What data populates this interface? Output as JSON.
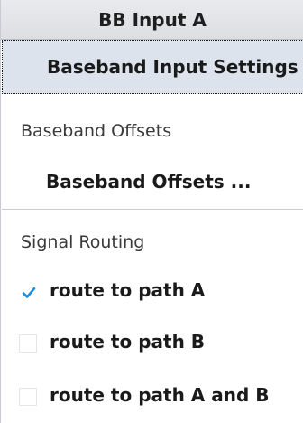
{
  "header": {
    "title": "BB Input A"
  },
  "baseband_input": {
    "settings_label": "Baseband Input Settings ..."
  },
  "offsets": {
    "section_label": "Baseband Offsets",
    "button_label": "Baseband Offsets ..."
  },
  "routing": {
    "section_label": "Signal Routing",
    "options": [
      {
        "label": "route to path A",
        "checked": true
      },
      {
        "label": "route to path B",
        "checked": false
      },
      {
        "label": "route to path A and B",
        "checked": false
      }
    ]
  },
  "colors": {
    "checkmark": "#1a8fe0",
    "selected_bg": "#dde3ec",
    "title_bg": "#e2e4e8"
  }
}
